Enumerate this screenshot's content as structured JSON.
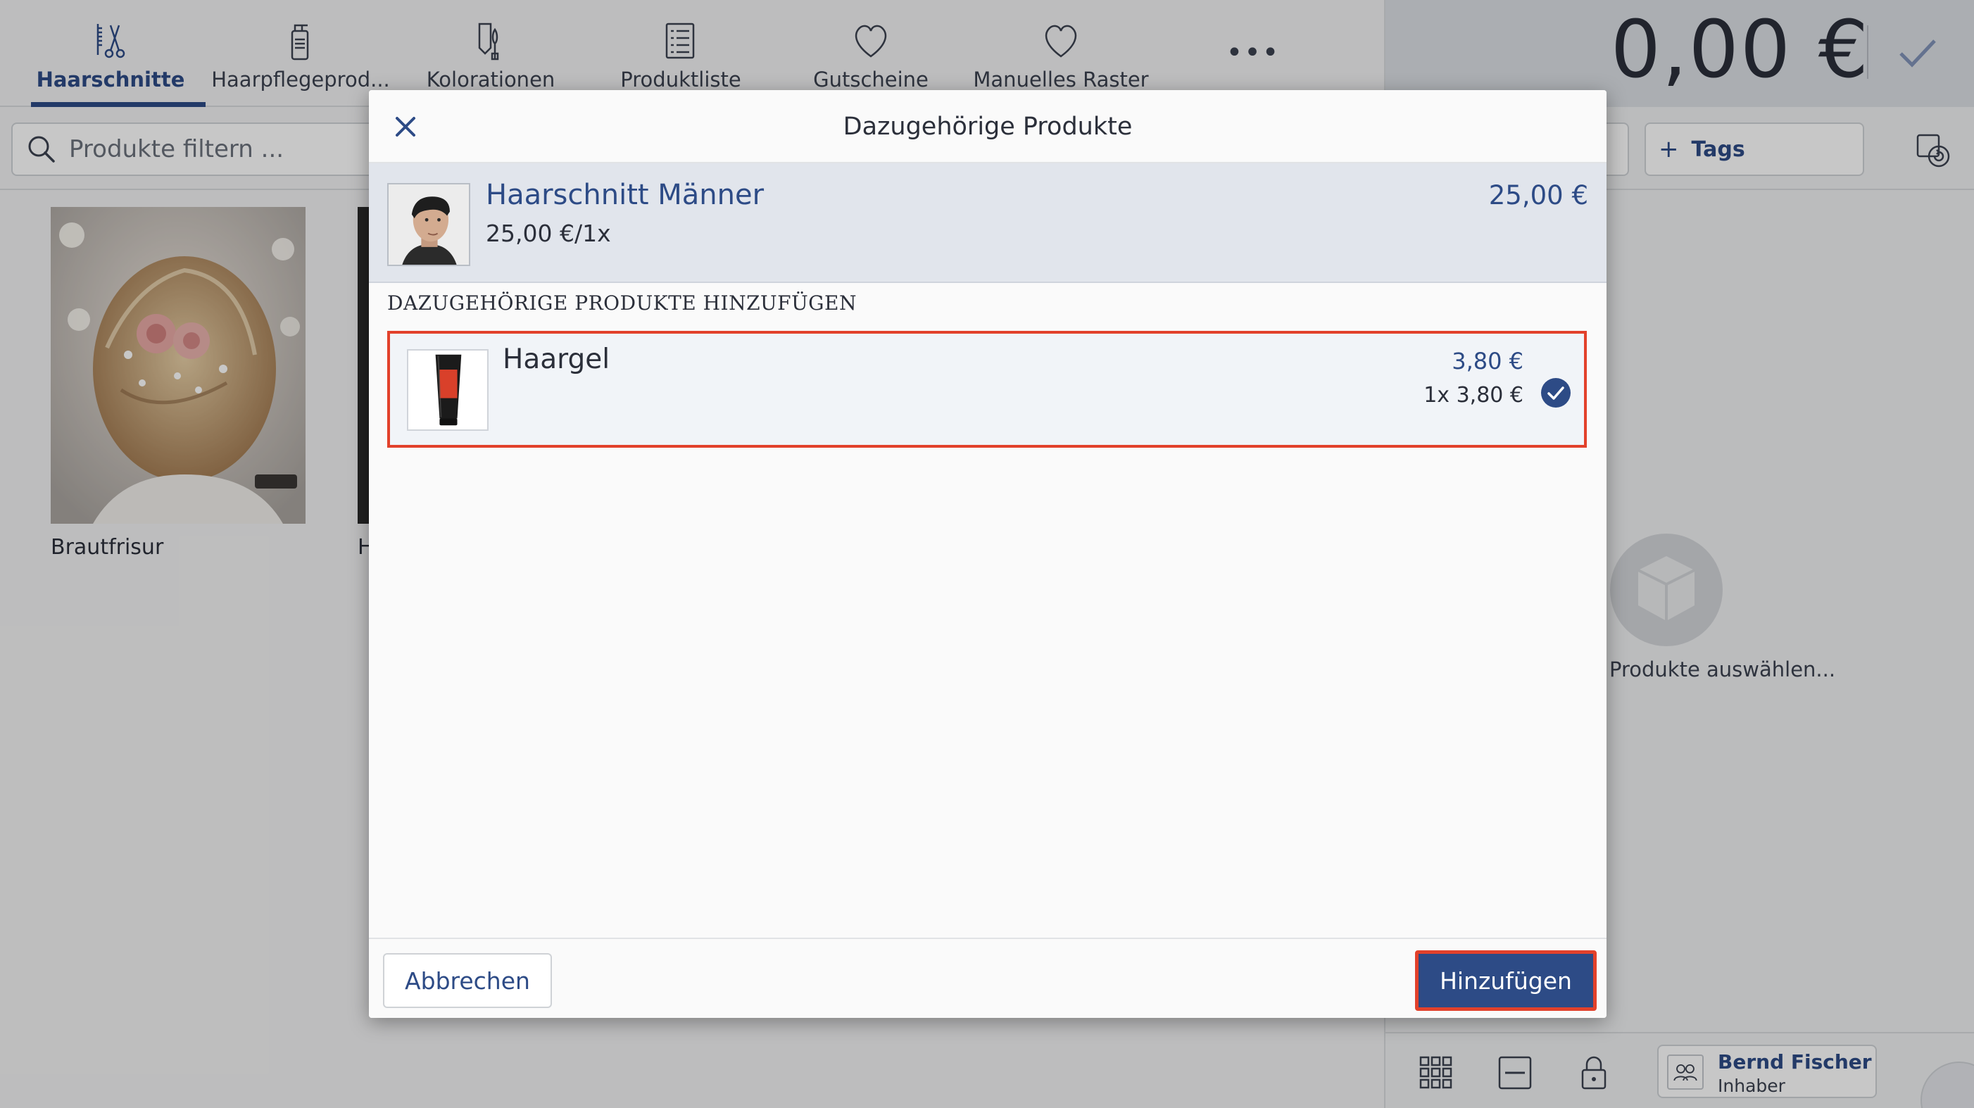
{
  "tabs": [
    {
      "label": "Haarschnitte",
      "icon": "scissors-comb-icon",
      "active": true
    },
    {
      "label": "Haarpflegeprod...",
      "icon": "hair-product-bottle-icon",
      "active": false
    },
    {
      "label": "Kolorationen",
      "icon": "coloring-tube-icon",
      "active": false
    },
    {
      "label": "Produktliste",
      "icon": "list-icon",
      "active": false
    },
    {
      "label": "Gutscheine",
      "icon": "heart-icon",
      "active": false
    },
    {
      "label": "Manuelles Raster",
      "icon": "heart-icon",
      "active": false
    }
  ],
  "more_label": "•••",
  "search": {
    "placeholder": "Produkte filtern ..."
  },
  "products": [
    {
      "label": "Brautfrisur"
    },
    {
      "label": "H"
    }
  ],
  "cart": {
    "total": "0,00 €",
    "tags_label": "Tags",
    "empty_label": "Produkte auswählen..."
  },
  "user": {
    "name": "Bernd Fischer",
    "role": "Inhaber"
  },
  "modal": {
    "title": "Dazugehörige Produkte",
    "main_product": {
      "name": "Haarschnitt Männer",
      "unit_price": "25,00 €/1x",
      "price": "25,00 €"
    },
    "section_heading": "DAZUGEHÖRIGE PRODUKTE HINZUFÜGEN",
    "addons": [
      {
        "name": "Haargel",
        "price": "3,80 €",
        "qty_line": "1x 3,80 €",
        "selected": true
      }
    ],
    "cancel_label": "Abbrechen",
    "add_label": "Hinzufügen"
  },
  "colors": {
    "accent": "#2d4b86",
    "highlight": "#e2412b"
  }
}
